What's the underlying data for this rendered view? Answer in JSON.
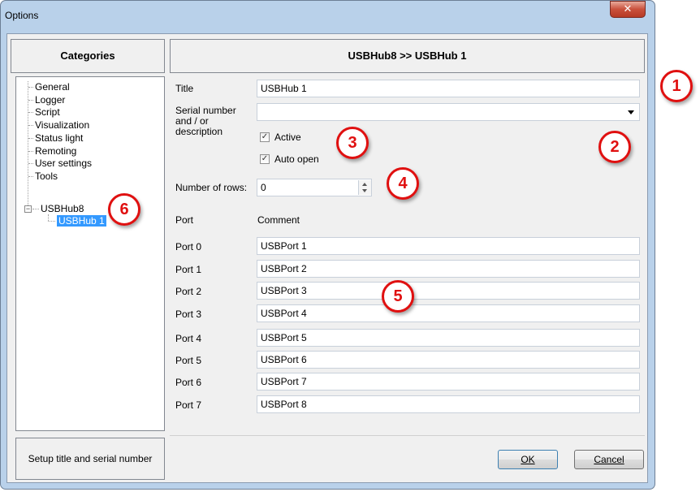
{
  "window": {
    "title": "Options",
    "close_glyph": "✕"
  },
  "categories": {
    "header": "Categories",
    "items": [
      "General",
      "Logger",
      "Script",
      "Visualization",
      "Status light",
      "Remoting",
      "User settings",
      "Tools",
      "USBHub8"
    ],
    "child": "USBHub 1",
    "expander": "−"
  },
  "help_text": "Setup title and serial number",
  "main": {
    "header": "USBHub8 >> USBHub 1",
    "title_label": "Title",
    "title_value": "USBHub 1",
    "serial_label_1": "Serial number",
    "serial_label_2": "and / or",
    "serial_label_3": "description",
    "serial_value": "",
    "dropdown_icon": "dropdown-arrow-icon",
    "active_label": "Active",
    "active_checked": true,
    "auto_open_label": "Auto open",
    "auto_open_checked": true,
    "rows_label": "Number of rows:",
    "rows_value": "0",
    "port_col_header": "Port",
    "comment_col_header": "Comment",
    "ports": [
      {
        "port": "Port 0",
        "comment": "USBPort 1"
      },
      {
        "port": "Port 1",
        "comment": "USBPort 2"
      },
      {
        "port": "Port 2",
        "comment": "USBPort 3"
      },
      {
        "port": "Port 3",
        "comment": "USBPort 4"
      },
      {
        "port": "Port 4",
        "comment": "USBPort 5"
      },
      {
        "port": "Port 5",
        "comment": "USBPort 6"
      },
      {
        "port": "Port 6",
        "comment": "USBPort 7"
      },
      {
        "port": "Port 7",
        "comment": "USBPort 8"
      }
    ]
  },
  "buttons": {
    "ok": "OK",
    "cancel": "Cancel"
  },
  "callouts": [
    "1",
    "2",
    "3",
    "4",
    "5",
    "6"
  ],
  "colors": {
    "callout": "#e01010",
    "selection": "#3399ff"
  }
}
